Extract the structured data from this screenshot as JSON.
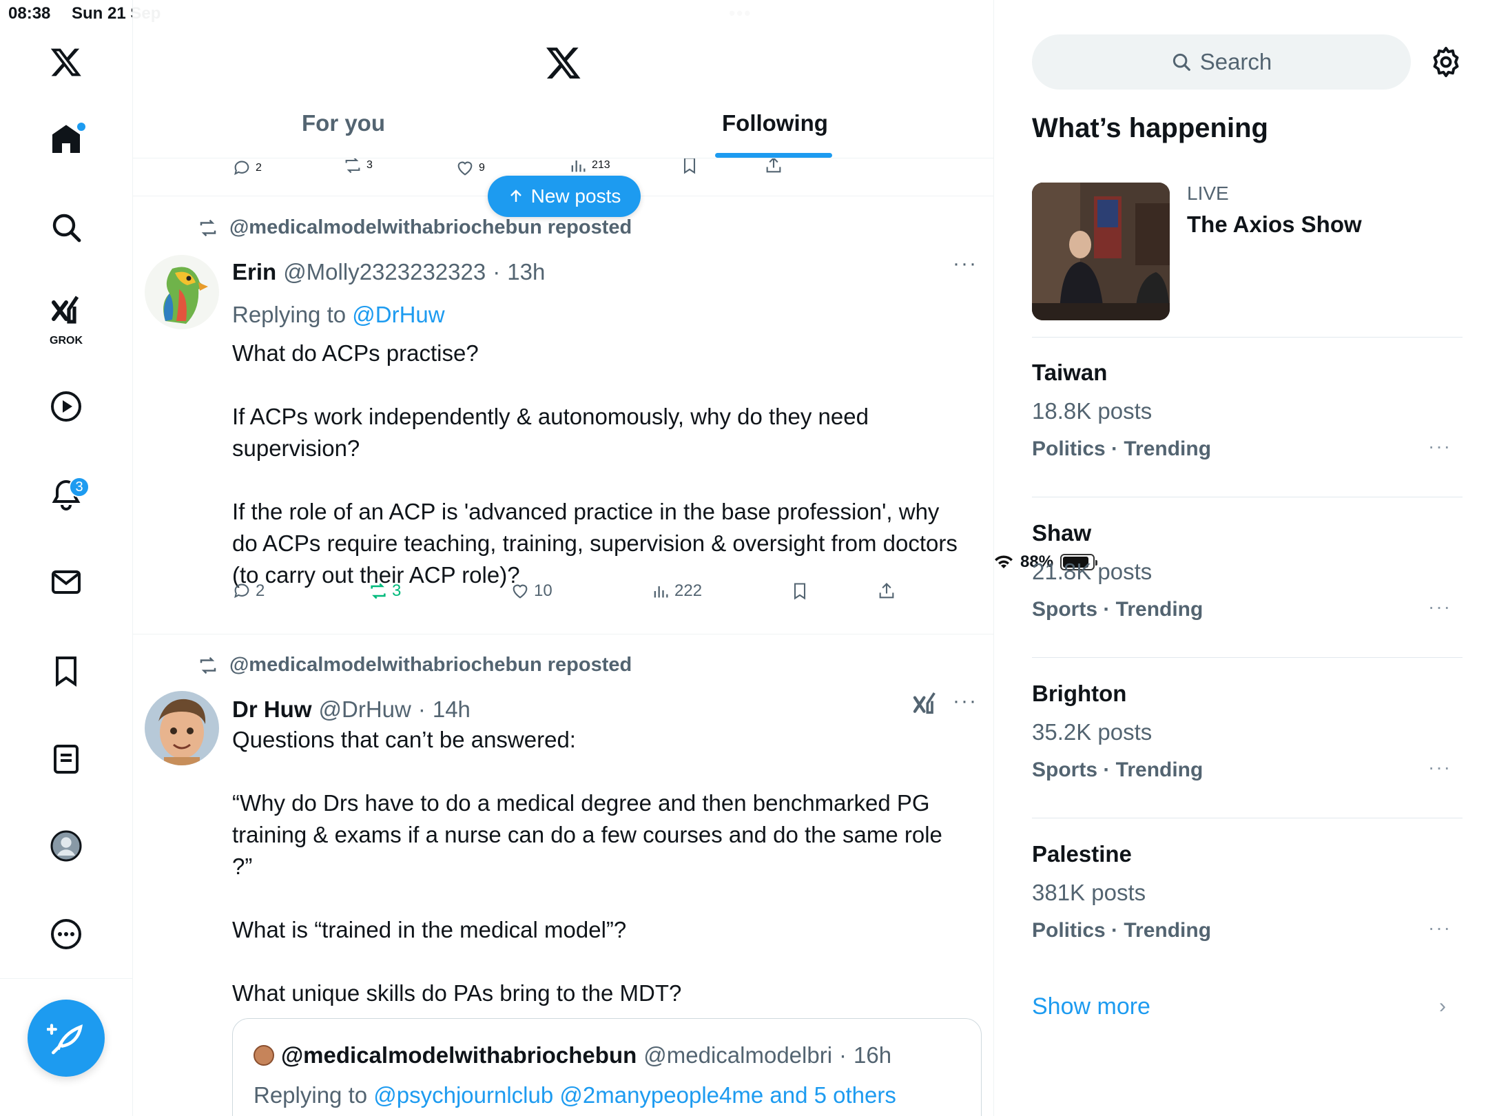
{
  "status_bar": {
    "time": "08:38",
    "date": "Sun 21 Sep",
    "battery": "88%",
    "battery_level": 0.88
  },
  "nav": {
    "grok_label": "GROK",
    "notifications_badge": "3"
  },
  "header": {
    "tabs": [
      {
        "label": "For you"
      },
      {
        "label": "Following"
      }
    ],
    "active_tab": "Following"
  },
  "prev_post_actions": {
    "replies": "2",
    "reposts": "3",
    "likes": "9",
    "views": "213"
  },
  "new_posts_label": "New posts",
  "posts": [
    {
      "repost_text": "@medicalmodelwithabriochebun reposted",
      "name": "Erin",
      "handle": "@Molly2323232323",
      "dot": "·",
      "time": "13h",
      "replying_prefix": "Replying to ",
      "replying_to": "@DrHuw",
      "body": "What do ACPs practise?\n\nIf ACPs work independently & autonomously, why do they need supervision?\n\nIf the role of an ACP is 'advanced practice in the base profession', why do ACPs require teaching, training, supervision & oversight from doctors (to carry out their ACP role)?",
      "actions": {
        "replies": "2",
        "reposts": "3",
        "likes": "10",
        "views": "222"
      },
      "more": "···"
    },
    {
      "repost_text": "@medicalmodelwithabriochebun reposted",
      "name": "Dr Huw",
      "handle": "@DrHuw",
      "dot": "·",
      "time": "14h",
      "body": "Questions that can’t be answered:\n\n“Why do Drs have to do a medical degree and then benchmarked PG training & exams if a nurse can do a few courses and do the same role ?”\n\nWhat is “trained in the medical model”?\n\nWhat unique skills do PAs bring to the MDT?",
      "more": "···",
      "quote": {
        "name": "@medicalmodelwithabriochebun",
        "handle": "@medicalmodelbri",
        "dot": "·",
        "time": "16h",
        "replying_prefix": "Replying to ",
        "replying_to": "@psychjournlclub @2manypeople4me and 5 others"
      }
    }
  ],
  "right": {
    "search_placeholder": "Search",
    "section_title": "What’s happening",
    "live": {
      "label": "LIVE",
      "title": "The Axios Show"
    },
    "trends": [
      {
        "name": "Taiwan",
        "count": "18.8K posts",
        "category": "Politics · Trending"
      },
      {
        "name": "Shaw",
        "count": "21.8K posts",
        "category": "Sports · Trending"
      },
      {
        "name": "Brighton",
        "count": "35.2K posts",
        "category": "Sports · Trending"
      },
      {
        "name": "Palestine",
        "count": "381K posts",
        "category": "Politics · Trending"
      }
    ],
    "trend_more": "···",
    "show_more": "Show more",
    "chevron": "›"
  },
  "colors": {
    "accent": "#1d9bf0",
    "repost_green": "#00ba7c",
    "secondary_text": "#536471"
  }
}
